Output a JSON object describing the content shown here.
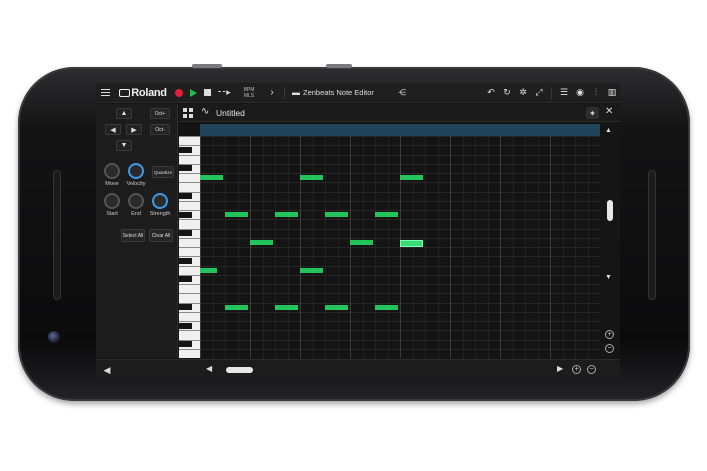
{
  "topbar": {
    "brand": "Roland",
    "bpm_label": "BPM",
    "bpm_sub": "MLS",
    "loop_glyph": "⁃⁃▸",
    "title": "Zenbeats Note Editor"
  },
  "left_panel": {
    "oct_up": "Oct+",
    "oct_down": "Oct-",
    "knobs": [
      {
        "label": "Move"
      },
      {
        "label": "Velocity"
      },
      {
        "label": "Start"
      },
      {
        "label": "End"
      },
      {
        "label": "Strength"
      }
    ],
    "quantize": "Quantize",
    "select_all": "Select All",
    "clear_all": "Clear All"
  },
  "editor": {
    "clip_title": "Untitled"
  },
  "piano_roll": {
    "steps": 32,
    "rows": 24,
    "notes": [
      {
        "row": 4,
        "start": 0,
        "len": 2
      },
      {
        "row": 4,
        "start": 8,
        "len": 2
      },
      {
        "row": 4,
        "start": 16,
        "len": 2
      },
      {
        "row": 8,
        "start": 2,
        "len": 2
      },
      {
        "row": 8,
        "start": 6,
        "len": 2
      },
      {
        "row": 8,
        "start": 10,
        "len": 2
      },
      {
        "row": 8,
        "start": 14,
        "len": 2
      },
      {
        "row": 11,
        "start": 4,
        "len": 2
      },
      {
        "row": 11,
        "start": 12,
        "len": 2
      },
      {
        "row": 11,
        "start": 16,
        "len": 2,
        "selected": true
      },
      {
        "row": 14,
        "start": 0,
        "len": 1.5
      },
      {
        "row": 14,
        "start": 8,
        "len": 2
      },
      {
        "row": 18,
        "start": 2,
        "len": 2
      },
      {
        "row": 18,
        "start": 6,
        "len": 2
      },
      {
        "row": 18,
        "start": 10,
        "len": 2
      },
      {
        "row": 18,
        "start": 14,
        "len": 2
      }
    ]
  },
  "colors": {
    "note": "#23c45c",
    "record": "#e0203a",
    "play": "#21c04b",
    "knob_accent": "#3c9ae8",
    "timeline": "#1f4358"
  }
}
